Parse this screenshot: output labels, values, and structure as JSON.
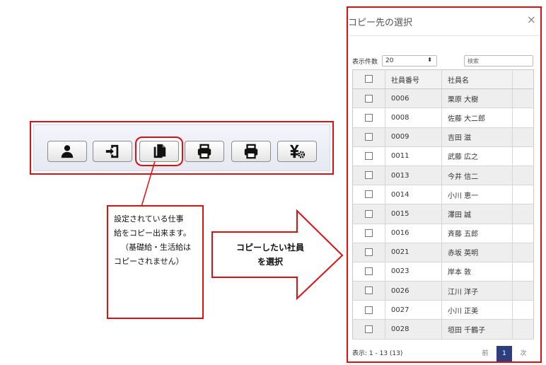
{
  "toolbar": {
    "buttons": [
      {
        "icon": "person-icon"
      },
      {
        "icon": "import-icon"
      },
      {
        "icon": "copy-icon"
      },
      {
        "icon": "print-icon"
      },
      {
        "icon": "print-icon"
      },
      {
        "icon": "yen-settings-icon"
      }
    ]
  },
  "callout": {
    "lines": [
      "設定されている仕事",
      "給をコピー出来ます。",
      "（基礎給・生活給は",
      "コピーされません）"
    ]
  },
  "arrow": {
    "lines": [
      "コピーしたい社員",
      "を選択"
    ]
  },
  "modal": {
    "title": "コピー先の選択",
    "close": "×",
    "per_page_label": "表示件数",
    "per_page_value": "20",
    "per_page_arrow": "⬍",
    "search_placeholder": "検索",
    "columns": {
      "code": "社員番号",
      "name": "社員名"
    },
    "rows": [
      {
        "code": "0006",
        "name": "栗原 大樹"
      },
      {
        "code": "0008",
        "name": "佐藤 大二郎"
      },
      {
        "code": "0009",
        "name": "吉田 滋"
      },
      {
        "code": "0011",
        "name": "武藤 広之"
      },
      {
        "code": "0013",
        "name": "今井 信二"
      },
      {
        "code": "0014",
        "name": "小川 恵一"
      },
      {
        "code": "0015",
        "name": "澤田 誠"
      },
      {
        "code": "0016",
        "name": "斉藤 五郎"
      },
      {
        "code": "0021",
        "name": "赤坂 英明"
      },
      {
        "code": "0023",
        "name": "岸本 敦"
      },
      {
        "code": "0026",
        "name": "江川 洋子"
      },
      {
        "code": "0027",
        "name": "小川 正美"
      },
      {
        "code": "0028",
        "name": "垣田 千鶴子"
      }
    ],
    "info": "表示: 1 - 13 (13)",
    "pager": {
      "prev": "前",
      "current": "1",
      "next": "次"
    }
  },
  "colors": {
    "highlight": "#e01010",
    "pager_active": "#2c3e7b"
  }
}
